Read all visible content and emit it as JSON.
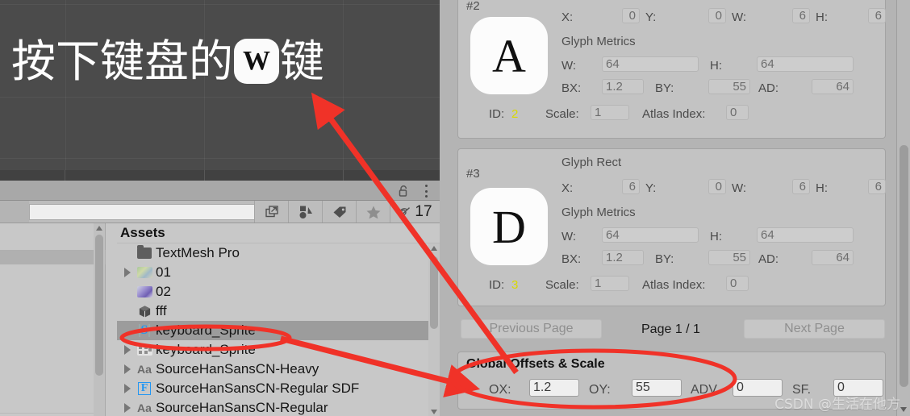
{
  "game_view": {
    "text_before": "按下键盘的",
    "keycap": "W",
    "text_after": "键"
  },
  "panel_header": {
    "lock_icon": "unlocked-padlock-icon",
    "menu_icon": "kebab-menu-icon"
  },
  "toolbar": {
    "search_value": "",
    "search_placeholder": "",
    "icons": [
      "open-in-new-icon",
      "shapes-filter-icon",
      "label-tag-icon",
      "favorite-star-icon",
      "visibility-off-icon"
    ],
    "count": "17"
  },
  "project": {
    "assets_title": "Assets",
    "rows": [
      {
        "label": "TextMesh Pro",
        "icon": "folder-icon",
        "expandable": false,
        "selected": false
      },
      {
        "label": "01",
        "icon": "texture-icon",
        "expandable": true,
        "selected": false
      },
      {
        "label": "02",
        "icon": "texture-icon-2",
        "expandable": false,
        "selected": false
      },
      {
        "label": "fff",
        "icon": "prefab-cube-icon",
        "expandable": false,
        "selected": false
      },
      {
        "label": "keyboard_Sprite",
        "icon": "sprite-S-icon",
        "expandable": false,
        "selected": true
      },
      {
        "label": "keyboard_Sprite",
        "icon": "spritesheet-icon",
        "expandable": true,
        "selected": false
      },
      {
        "label": "SourceHanSansCN-Heavy",
        "icon": "font-Aa-icon",
        "expandable": true,
        "selected": false
      },
      {
        "label": "SourceHanSansCN-Regular SDF",
        "icon": "fontasset-F-icon",
        "expandable": true,
        "selected": false
      },
      {
        "label": "SourceHanSansCN-Regular",
        "icon": "font-Aa-icon",
        "expandable": true,
        "selected": false
      }
    ]
  },
  "inspector": {
    "glyph_rect_label": "Glyph Rect",
    "glyph_metrics_label": "Glyph Metrics",
    "labels": {
      "x": "X:",
      "y": "Y:",
      "w": "W:",
      "h": "H:",
      "mw": "W:",
      "mh": "H:",
      "bx": "BX:",
      "by": "BY:",
      "ad": "AD:",
      "id": "ID:",
      "scale": "Scale:",
      "atlas": "Atlas Index:"
    },
    "glyphs": [
      {
        "number": "#2",
        "preview_char": "A",
        "rect": {
          "x": "0",
          "y": "0",
          "w": "6",
          "h": "6"
        },
        "metrics": {
          "w": "64",
          "h": "64",
          "bx": "1.2",
          "by": "55",
          "ad": "64"
        },
        "id": "2",
        "scale": "1",
        "atlas_index": "0",
        "show_rect_heading": false
      },
      {
        "number": "#3",
        "preview_char": "D",
        "rect": {
          "x": "6",
          "y": "0",
          "w": "6",
          "h": "6"
        },
        "metrics": {
          "w": "64",
          "h": "64",
          "bx": "1.2",
          "by": "55",
          "ad": "64"
        },
        "id": "3",
        "scale": "1",
        "atlas_index": "0",
        "show_rect_heading": true
      }
    ],
    "pagination": {
      "previous": "Previous Page",
      "page_label": "Page 1 / 1",
      "next": "Next Page"
    },
    "global": {
      "title": "Global Offsets & Scale",
      "ox_label": "OX:",
      "ox_value": "1.2",
      "oy_label": "OY:",
      "oy_value": "55",
      "adv_label": "ADV.",
      "adv_value": "0",
      "sf_label": "SF.",
      "sf_value": "0"
    }
  },
  "watermark": "CSDN @生活在他方",
  "colors": {
    "annotation_red": "#f03228",
    "gameview_bg": "#4b4b4b",
    "panel_bg": "#c8c8c8",
    "inspector_bg": "#b4b4b4",
    "id_yellow": "#d9d900",
    "selection_blue_icon": "#2196f3"
  }
}
